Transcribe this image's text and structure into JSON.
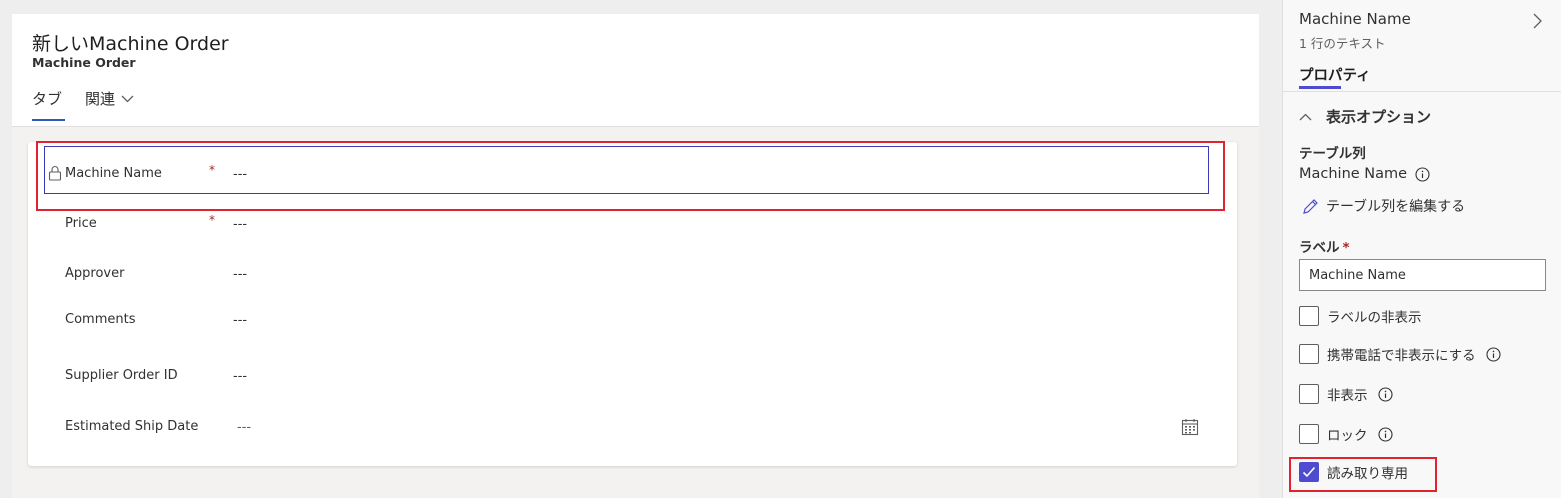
{
  "form": {
    "title": "新しいMachine Order",
    "subtitle": "Machine Order",
    "tabs": [
      {
        "label": "タブ",
        "active": true
      },
      {
        "label": "関連",
        "active": false,
        "has_dropdown": true
      }
    ],
    "required_marker": "*",
    "fields": [
      {
        "label": "Machine Name",
        "value": "---",
        "required": true,
        "locked": true,
        "selected": true
      },
      {
        "label": "Price",
        "value": "---",
        "required": true
      },
      {
        "label": "Approver",
        "value": "---",
        "required": false
      },
      {
        "label": "Comments",
        "value": "---",
        "required": false
      },
      {
        "label": "Supplier Order ID",
        "value": "---",
        "required": false
      },
      {
        "label": "Estimated Ship Date",
        "value": "---",
        "required": false,
        "icon": "calendar-icon"
      }
    ]
  },
  "pane": {
    "title": "Machine Name",
    "type": "1 行のテキスト",
    "tab": "プロパティ",
    "section": "表示オプション",
    "table_column_heading": "テーブル列",
    "table_column_value": "Machine Name",
    "edit_link": "テーブル列を編集する",
    "label_heading": "ラベル",
    "required_marker": "*",
    "label_value": "Machine Name",
    "options": [
      {
        "label": "ラベルの非表示",
        "checked": false,
        "info": false
      },
      {
        "label": "携帯電話で非表示にする",
        "checked": false,
        "info": true
      },
      {
        "label": "非表示",
        "checked": false,
        "info": true
      },
      {
        "label": "ロック",
        "checked": false,
        "info": true
      },
      {
        "label": "読み取り専用",
        "checked": true,
        "info": false
      }
    ]
  },
  "colors": {
    "accent": "#4f4bd1",
    "highlight": "#e0232e",
    "required": "#a4262c"
  }
}
